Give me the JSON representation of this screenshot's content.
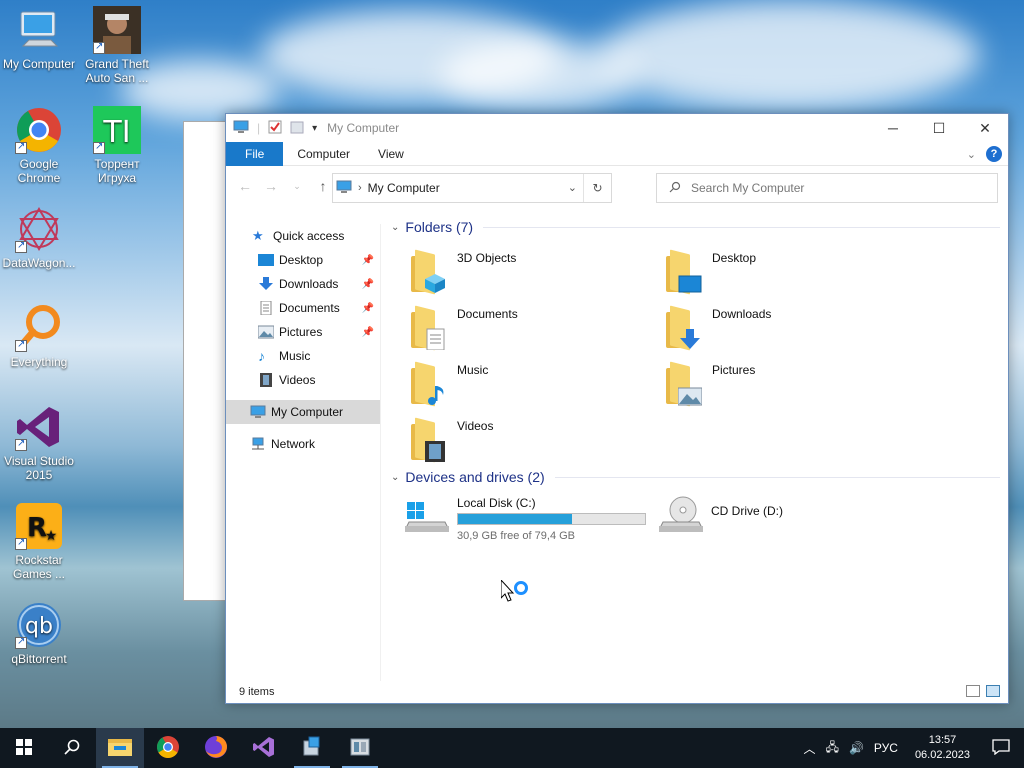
{
  "desktop": {
    "icons": [
      {
        "label": "My Computer",
        "icon": "computer-icon"
      },
      {
        "label": "Grand Theft Auto San ...",
        "icon": "gta-icon"
      },
      {
        "label": "Google Chrome",
        "icon": "chrome-icon"
      },
      {
        "label": "Торрент Игруха",
        "icon": "torrent-igruha-icon"
      },
      {
        "label": "DataWagon...",
        "icon": "datawagon-icon"
      },
      {
        "label": "Everything",
        "icon": "everything-icon"
      },
      {
        "label": "Visual Studio 2015",
        "icon": "visual-studio-icon"
      },
      {
        "label": "Rockstar Games ...",
        "icon": "rockstar-icon"
      },
      {
        "label": "qBittorrent",
        "icon": "qbittorrent-icon"
      }
    ]
  },
  "explorer": {
    "title": "My Computer",
    "ribbon_tabs": [
      "File",
      "Computer",
      "View"
    ],
    "address": "My Computer",
    "search_placeholder": "Search My Computer",
    "nav": {
      "quick_access": "Quick access",
      "items": [
        "Desktop",
        "Downloads",
        "Documents",
        "Pictures",
        "Music",
        "Videos"
      ],
      "my_computer": "My Computer",
      "network": "Network"
    },
    "folders_header": "Folders (7)",
    "folders": [
      "3D Objects",
      "Desktop",
      "Documents",
      "Downloads",
      "Music",
      "Pictures",
      "Videos"
    ],
    "drives_header": "Devices and drives (2)",
    "drives": [
      {
        "name": "Local Disk (C:)",
        "free": "30,9 GB free of 79,4 GB",
        "used_fraction": 0.61
      },
      {
        "name": "CD Drive (D:)"
      }
    ],
    "status": "9 items"
  },
  "taskbar": {
    "language": "РУС",
    "time": "13:57",
    "date": "06.02.2023"
  },
  "colors": {
    "accent": "#1979ca",
    "drive_bar": "#26a0da",
    "taskbar": "#101820"
  }
}
